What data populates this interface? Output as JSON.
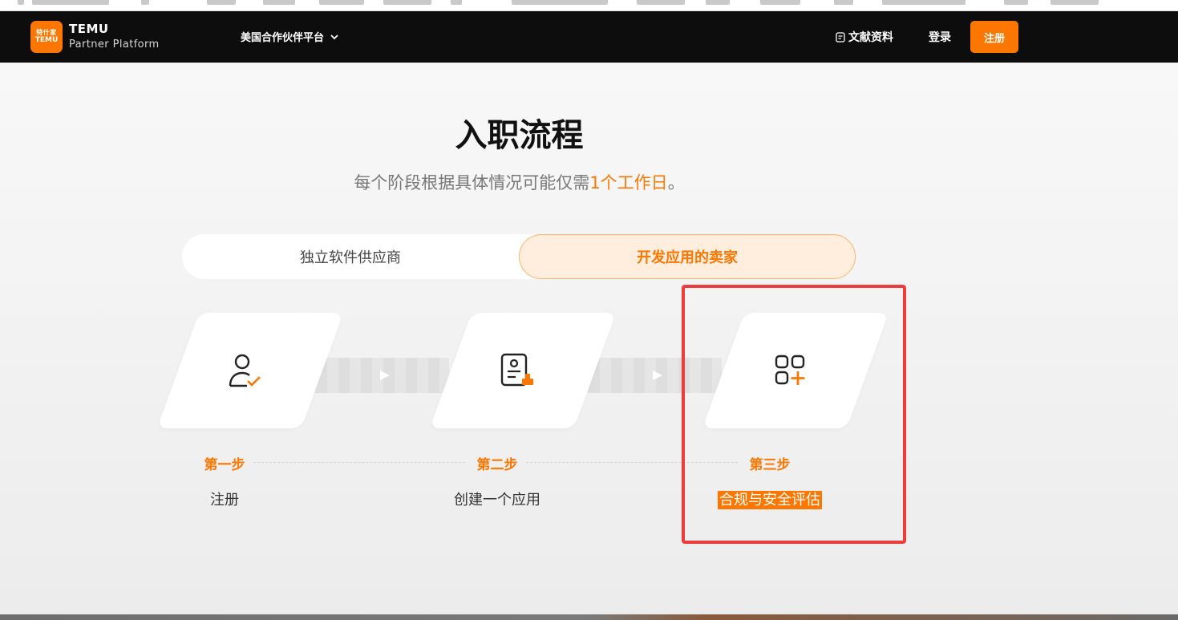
{
  "navbar": {
    "brand_title": "TEMU",
    "brand_subtitle": "Partner Platform",
    "logo_top": "特什家",
    "logo_bottom": "TEMU",
    "region_label": "美国合作伙伴平台",
    "docs_label": "文献资料",
    "login_label": "登录",
    "register_label": "注册"
  },
  "hero": {
    "title": "入职流程",
    "subtitle_prefix": "每个阶段根据具体情况可能仅需",
    "subtitle_highlight": "1个工作日",
    "subtitle_suffix": "。"
  },
  "tabs": [
    {
      "label": "独立软件供应商",
      "active": false
    },
    {
      "label": "开发应用的卖家",
      "active": true
    }
  ],
  "steps": [
    {
      "label": "第一步",
      "name": "注册",
      "icon": "user-check-icon"
    },
    {
      "label": "第二步",
      "name": "创建一个应用",
      "icon": "document-user-icon"
    },
    {
      "label": "第三步",
      "name": "合规与安全评估",
      "icon": "apps-add-icon",
      "selected": true
    }
  ],
  "colors": {
    "accent": "#fb7701",
    "nav_bg": "#0d0d0d",
    "highlight_border": "#ef3b3b"
  }
}
